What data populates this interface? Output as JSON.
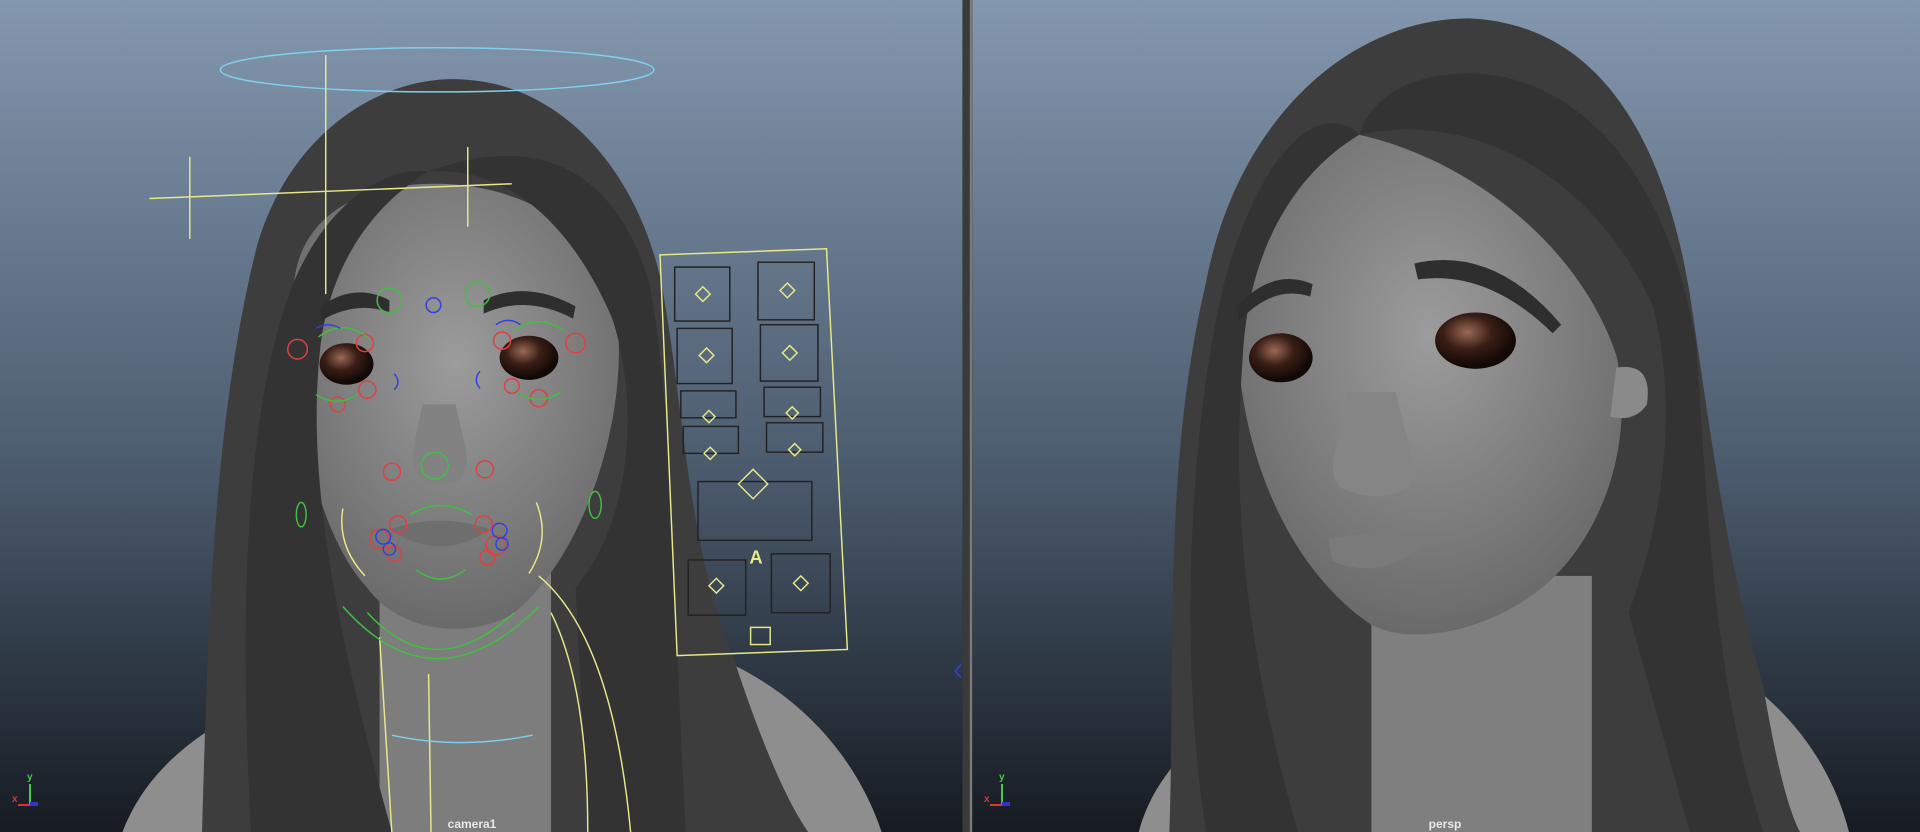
{
  "viewports": [
    {
      "camera": "camera1",
      "axis": {
        "x": "x",
        "y": "y",
        "z": "z"
      }
    },
    {
      "camera": "persp",
      "axis": {
        "x": "x",
        "y": "y",
        "z": "z"
      }
    }
  ],
  "rig_panel": {
    "label": "A"
  },
  "colors": {
    "bg_top": "#8397ae",
    "bg_bottom": "#161b22",
    "hair": "#3b3b3b",
    "skin": "#8c8c8c",
    "control_yellow": "#e6e88a",
    "halo": "#7fd0ee"
  }
}
